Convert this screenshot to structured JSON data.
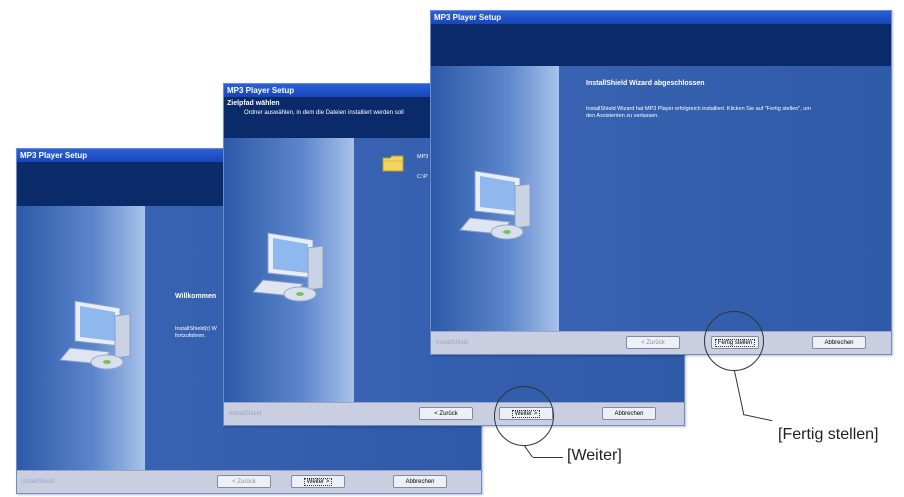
{
  "windows": [
    {
      "title": "MP3 Player Setup",
      "content_title": "Willkommen",
      "content_text": [
        "InstallShield(r) W",
        "fortzufahren."
      ],
      "brand": "InstallShield",
      "buttons": {
        "back": "< Zurück",
        "next": "Weiter >",
        "cancel": "Abbrechen"
      }
    },
    {
      "title": "MP3 Player Setup",
      "header_title": "Zielpfad wählen",
      "header_subtitle": "Ordner auswählen, in dem die Dateien installiert werden soll",
      "folder_name": "MP3",
      "folder_path": "C:\\P",
      "brand": "InstallShield",
      "buttons": {
        "back": "< Zurück",
        "next": "Weiter >",
        "cancel": "Abbrechen"
      }
    },
    {
      "title": "MP3 Player Setup",
      "content_title": "InstallShield Wizard abgeschlossen",
      "content_text": [
        "InstallShield Wizard hat MP3 Player erfolgreich installiert. Klicken Sie auf \"Fertig stellen\", um",
        "den Assistenten zu verlassen."
      ],
      "brand": "InstallShield",
      "buttons": {
        "back": "< Zurück",
        "finish": "Fertig stellen",
        "cancel": "Abbrechen"
      }
    }
  ],
  "callouts": {
    "weiter": "[Weiter]",
    "fertig": "[Fertig stellen]"
  }
}
